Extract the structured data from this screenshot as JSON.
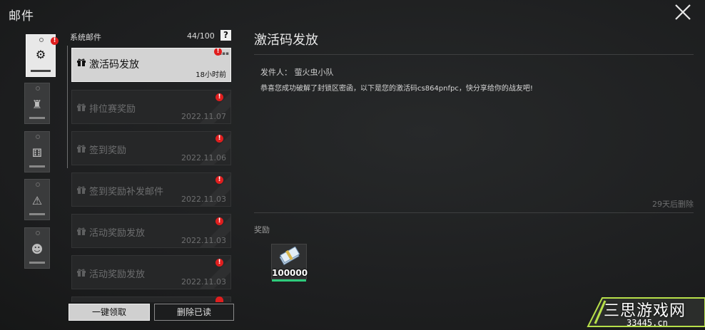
{
  "window": {
    "title": "邮件"
  },
  "close_icon": "close-icon",
  "categories": [
    {
      "name": "system",
      "icon": "gear-icon",
      "badge": "!"
    },
    {
      "name": "competition",
      "icon": "trophy-icon"
    },
    {
      "name": "dice",
      "icon": "dice-icon"
    },
    {
      "name": "warning",
      "icon": "warning-icon"
    },
    {
      "name": "character",
      "icon": "character-icon"
    }
  ],
  "list": {
    "label": "系统邮件",
    "count": "44/100",
    "help": "?",
    "items": [
      {
        "subject": "激活码发放",
        "time": "18小时前",
        "badge": "!"
      },
      {
        "subject": "排位赛奖励",
        "time": "2022.11.07",
        "badge": "!"
      },
      {
        "subject": "签到奖励",
        "time": "2022.11.06",
        "badge": "!"
      },
      {
        "subject": "签到奖励补发邮件",
        "time": "2022.11.03",
        "badge": "!"
      },
      {
        "subject": "活动奖励发放",
        "time": "2022.11.03",
        "badge": "!"
      },
      {
        "subject": "活动奖励发放",
        "time": "2022.11.03",
        "badge": "!"
      }
    ]
  },
  "buttons": {
    "claim_all": "一键领取",
    "delete_read": "删除已读"
  },
  "detail": {
    "title": "激活码发放",
    "sender": "发件人：  萤火虫小队",
    "body": "恭喜您成功破解了封锁区密函，以下是您的激活码cs864pnfpc，快分享给你的战友吧!",
    "expire": "29天后删除",
    "rewards_label": "奖励",
    "rewards": [
      {
        "icon": "cash-bundle-icon",
        "qty": "100000"
      }
    ]
  },
  "watermark": {
    "text": "三思游戏网",
    "url": "33445.cn"
  },
  "colors": {
    "badge": "#e01e1e",
    "reward_bar": "#2ecb7c",
    "selected_bg": "#d3d3d3"
  }
}
